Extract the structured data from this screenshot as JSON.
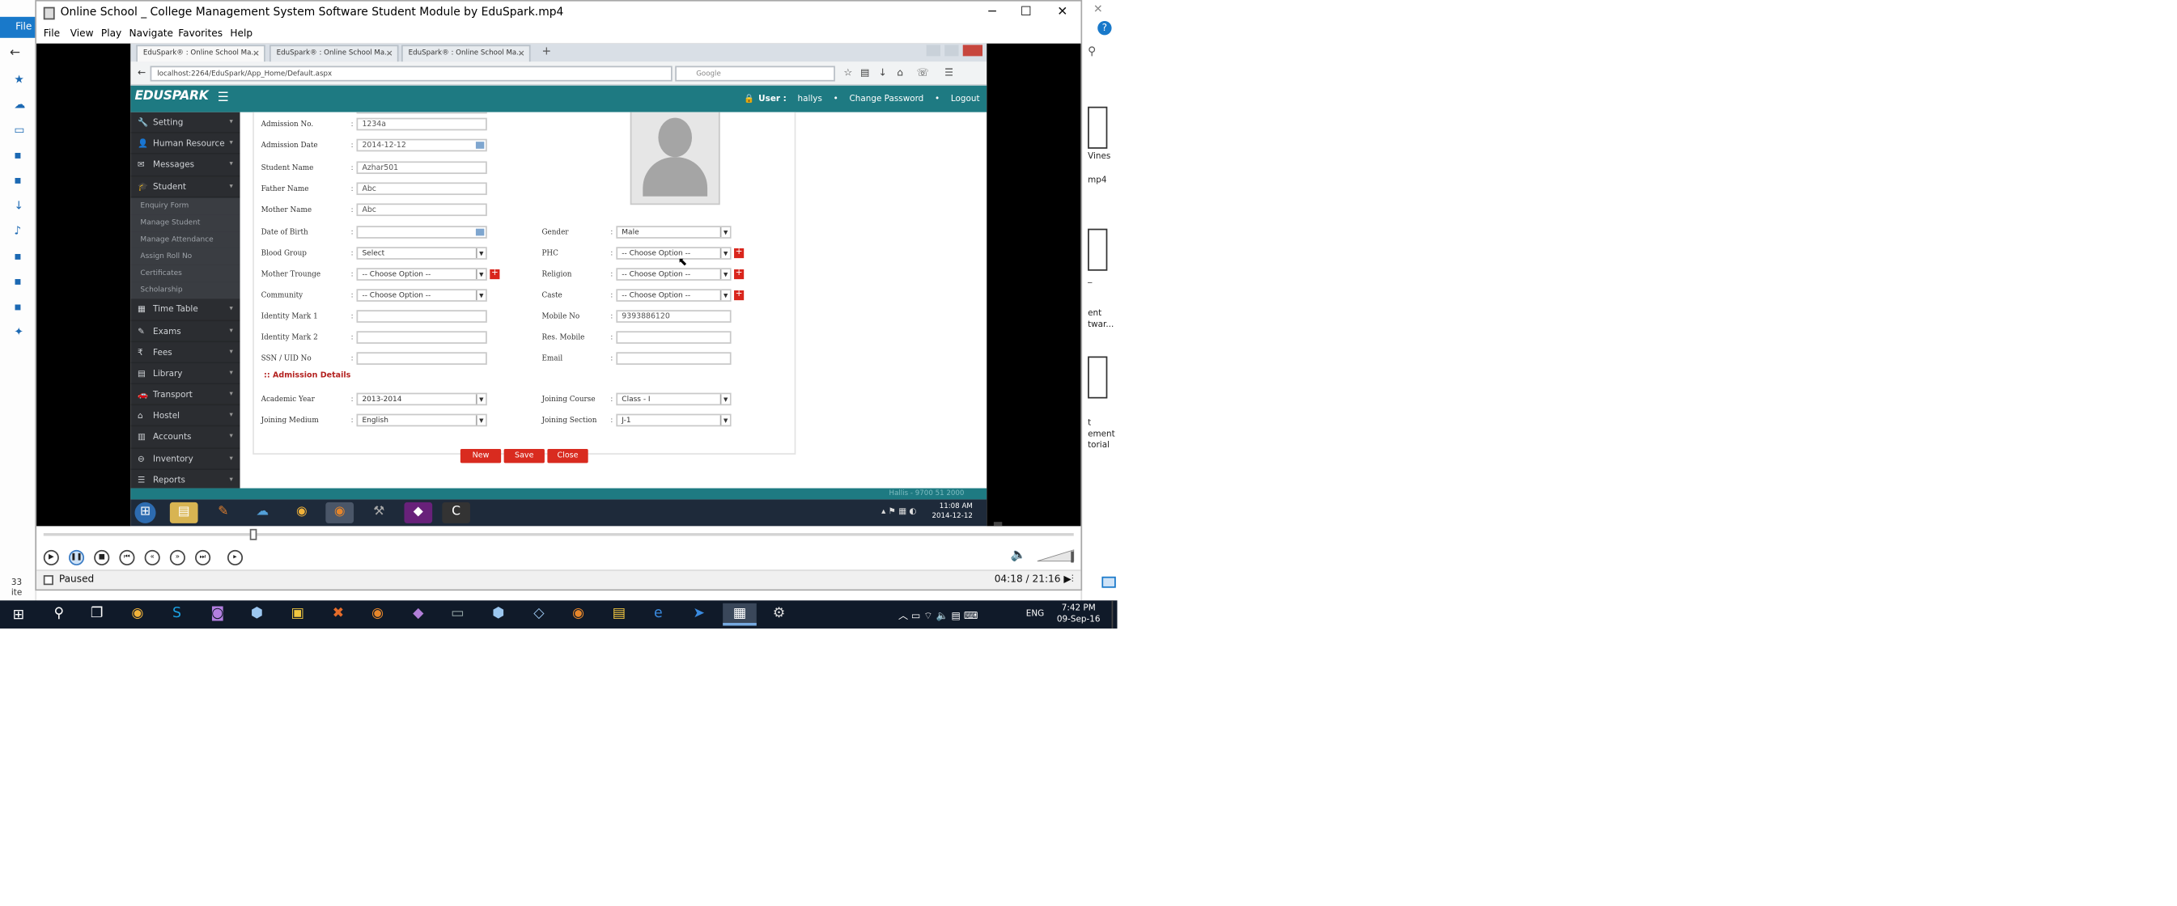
{
  "background": {
    "explorer_file_tab": "File",
    "explorer_items_count": "33 ite",
    "right_caps": [
      "Vines",
      "mp4",
      "_",
      "ent",
      "twar...",
      "t",
      "ement",
      "torial"
    ]
  },
  "player": {
    "title": "Online School _ College Management System Software Student Module by EduSpark.mp4",
    "menu": [
      "File",
      "View",
      "Play",
      "Navigate",
      "Favorites",
      "Help"
    ],
    "status": "Paused",
    "time": "04:18 / 21:16"
  },
  "inner_browser": {
    "tabs": [
      "EduSpark® : Online School Ma...",
      "EduSpark® : Online School Ma...",
      "EduSpark® : Online School Ma..."
    ],
    "url": "localhost:2264/EduSpark/App_Home/Default.aspx",
    "search_placeholder": "Google"
  },
  "app": {
    "logo": "EDUSPARK",
    "user_label": "User :",
    "user_name": "hallys",
    "change_password": "Change Password",
    "logout": "Logout",
    "footer": "Hallis - 9700 51 2000",
    "sidebar": [
      {
        "label": "Setting",
        "icon": "wrench-icon",
        "glyph": "🔧"
      },
      {
        "label": "Human Resource",
        "icon": "user-icon",
        "glyph": "👤"
      },
      {
        "label": "Messages",
        "icon": "envelope-icon",
        "glyph": "✉"
      },
      {
        "label": "Student",
        "icon": "student-icon",
        "glyph": "🎓"
      }
    ],
    "sidebar_sub": [
      "Enquiry Form",
      "Manage Student",
      "Manage Attendance",
      "Assign Roll No",
      "Certificates",
      "Scholarship"
    ],
    "sidebar_more": [
      {
        "label": "Time Table",
        "icon": "calendar-icon",
        "glyph": "▦"
      },
      {
        "label": "Exams",
        "icon": "exam-icon",
        "glyph": "✎"
      },
      {
        "label": "Fees",
        "icon": "rupee-icon",
        "glyph": "₹"
      },
      {
        "label": "Library",
        "icon": "book-icon",
        "glyph": "▤"
      },
      {
        "label": "Transport",
        "icon": "car-icon",
        "glyph": "🚗"
      },
      {
        "label": "Hostel",
        "icon": "home-icon",
        "glyph": "⌂"
      },
      {
        "label": "Accounts",
        "icon": "bank-icon",
        "glyph": "▥"
      },
      {
        "label": "Inventory",
        "icon": "box-icon",
        "glyph": "⊖"
      },
      {
        "label": "Reports",
        "icon": "report-icon",
        "glyph": "☰"
      }
    ],
    "form": {
      "admission_no_label": "Admission No.",
      "admission_no": "1234a",
      "admission_date_label": "Admission Date",
      "admission_date": "2014-12-12",
      "student_name_label": "Student Name",
      "student_name": "Azhar501",
      "father_name_label": "Father Name",
      "father_name": "Abc",
      "mother_name_label": "Mother Name",
      "mother_name": "Abc",
      "dob_label": "Date of Birth",
      "dob": "",
      "blood_group_label": "Blood Group",
      "blood_group": "Select",
      "mother_tongue_label": "Mother Trounge",
      "mother_tongue": "-- Choose Option --",
      "community_label": "Community",
      "community": "-- Choose Option --",
      "identity1_label": "Identity Mark 1",
      "identity1": "",
      "identity2_label": "Identity Mark 2",
      "identity2": "",
      "ssn_label": "SSN / UID No",
      "ssn": "",
      "gender_label": "Gender",
      "gender": "Male",
      "phc_label": "PHC",
      "phc": "-- Choose Option --",
      "religion_label": "Religion",
      "religion": "-- Choose Option --",
      "caste_label": "Caste",
      "caste": "-- Choose Option --",
      "mobile_label": "Mobile No",
      "mobile": "9393886120",
      "res_mobile_label": "Res. Mobile",
      "res_mobile": "",
      "email_label": "Email",
      "email": "",
      "admission_section": ":: Admission Details",
      "academic_year_label": "Academic Year",
      "academic_year": "2013-2014",
      "joining_medium_label": "Joining Medium",
      "joining_medium": "English",
      "joining_course_label": "Joining Course",
      "joining_course": "Class - I",
      "joining_section_label": "Joining Section",
      "joining_section": "J-1",
      "colon": ":",
      "add_symbol": "+"
    },
    "buttons": {
      "new": "New",
      "save": "Save",
      "close": "Close"
    }
  },
  "inner_taskbar": {
    "time": "11:08 AM",
    "date": "2014-12-12"
  },
  "taskbar": {
    "lang": "ENG",
    "time": "7:42 PM",
    "date": "09-Sep-16"
  }
}
